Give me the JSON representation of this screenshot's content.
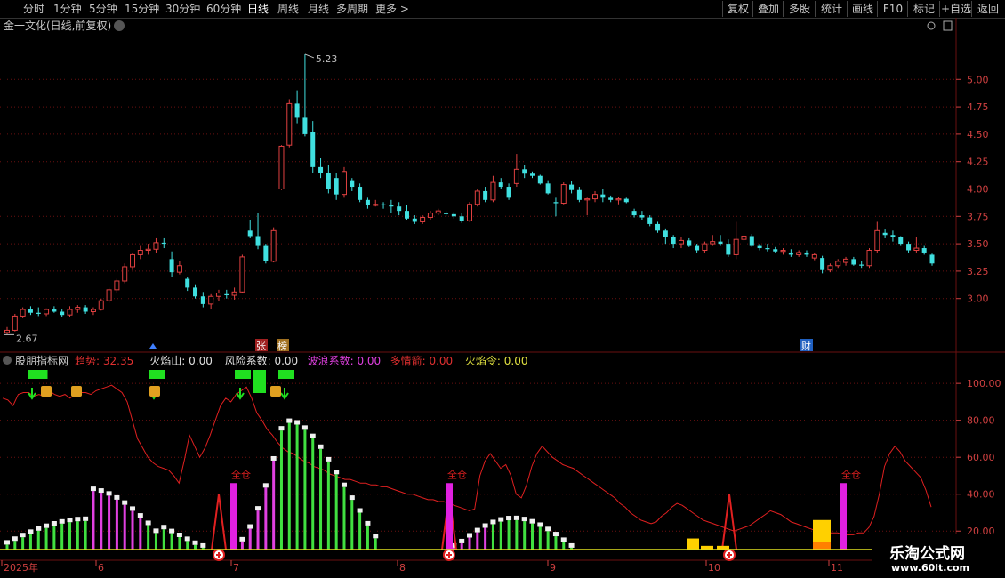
{
  "toolbar": {
    "periods": [
      "分时",
      "1分钟",
      "5分钟",
      "15分钟",
      "30分钟",
      "60分钟",
      "日线",
      "周线",
      "月线",
      "多周期",
      "更多 >"
    ],
    "active": "日线",
    "right": [
      "复权",
      "叠加",
      "多股",
      "统计",
      "画线",
      "F10",
      "标记",
      "+自选",
      "返回"
    ]
  },
  "main_title": "金一文化(日线,前复权)",
  "sub_title": "股朋指标网",
  "indicators": [
    {
      "name": "趋势:",
      "value": "32.35",
      "color": "#e03030"
    },
    {
      "name": "火焰山:",
      "value": "0.00",
      "color": "#e0e0e0"
    },
    {
      "name": "风险系数:",
      "value": "0.00",
      "color": "#e0e0e0"
    },
    {
      "name": "波浪系数:",
      "value": "0.00",
      "color": "#e040e0"
    },
    {
      "name": "多情箭:",
      "value": "0.00",
      "color": "#e03030"
    },
    {
      "name": "火焰令:",
      "value": "0.00",
      "color": "#e0e040"
    }
  ],
  "markers": {
    "zhang": "张",
    "bang": "榜",
    "cai": "财",
    "quancang": "全仓",
    "max_label": "5.23",
    "min_label": "2.67"
  },
  "x_labels": [
    "2025年",
    "6",
    "7",
    "8",
    "9",
    "10",
    "11"
  ],
  "watermark": {
    "line1": "乐淘公式网",
    "line2": "www.60lt.com"
  },
  "colors": {
    "up": "#e04040",
    "down": "#40e0e0",
    "grid": "#6a1010",
    "bg": "#000000"
  },
  "chart_data": [
    {
      "type": "candlestick",
      "title": "金一文化(日线,前复权)",
      "ylim": [
        2.6,
        5.4
      ],
      "yticks": [
        3.0,
        3.25,
        3.5,
        3.75,
        4.0,
        4.25,
        4.5,
        4.75,
        5.0
      ],
      "ohlc": [
        [
          2.69,
          2.74,
          2.67,
          2.71
        ],
        [
          2.71,
          2.86,
          2.7,
          2.84
        ],
        [
          2.84,
          2.92,
          2.82,
          2.9
        ],
        [
          2.9,
          2.93,
          2.85,
          2.87
        ],
        [
          2.87,
          2.92,
          2.84,
          2.86
        ],
        [
          2.86,
          2.91,
          2.84,
          2.9
        ],
        [
          2.9,
          2.93,
          2.87,
          2.88
        ],
        [
          2.88,
          2.9,
          2.83,
          2.85
        ],
        [
          2.85,
          2.93,
          2.83,
          2.9
        ],
        [
          2.9,
          2.94,
          2.87,
          2.92
        ],
        [
          2.92,
          2.94,
          2.86,
          2.88
        ],
        [
          2.88,
          2.92,
          2.85,
          2.9
        ],
        [
          2.9,
          3.0,
          2.89,
          2.98
        ],
        [
          2.98,
          3.1,
          2.96,
          3.08
        ],
        [
          3.08,
          3.18,
          3.05,
          3.16
        ],
        [
          3.16,
          3.32,
          3.14,
          3.29
        ],
        [
          3.29,
          3.42,
          3.26,
          3.4
        ],
        [
          3.4,
          3.48,
          3.36,
          3.44
        ],
        [
          3.44,
          3.5,
          3.4,
          3.45
        ],
        [
          3.45,
          3.55,
          3.42,
          3.51
        ],
        [
          3.51,
          3.55,
          3.46,
          3.5
        ],
        [
          3.36,
          3.43,
          3.2,
          3.24
        ],
        [
          3.24,
          3.34,
          3.22,
          3.3
        ],
        [
          3.18,
          3.2,
          3.07,
          3.1
        ],
        [
          3.1,
          3.13,
          3.0,
          3.02
        ],
        [
          3.02,
          3.06,
          2.92,
          2.95
        ],
        [
          2.95,
          3.04,
          2.9,
          3.02
        ],
        [
          3.02,
          3.08,
          2.98,
          3.05
        ],
        [
          3.04,
          3.08,
          3.0,
          3.03
        ],
        [
          3.03,
          3.1,
          2.99,
          3.06
        ],
        [
          3.06,
          3.4,
          3.05,
          3.38
        ],
        [
          3.62,
          3.72,
          3.55,
          3.57
        ],
        [
          3.57,
          3.78,
          3.45,
          3.48
        ],
        [
          3.48,
          3.5,
          3.32,
          3.34
        ],
        [
          3.34,
          3.65,
          3.33,
          3.62
        ],
        [
          4.0,
          4.4,
          3.99,
          4.39
        ],
        [
          4.4,
          4.82,
          4.38,
          4.78
        ],
        [
          4.78,
          4.9,
          4.6,
          4.65
        ],
        [
          4.65,
          5.23,
          4.48,
          4.5
        ],
        [
          4.52,
          4.62,
          4.15,
          4.2
        ],
        [
          4.2,
          4.28,
          4.1,
          4.15
        ],
        [
          4.15,
          4.22,
          3.96,
          4.0
        ],
        [
          4.1,
          4.15,
          3.9,
          3.95
        ],
        [
          3.95,
          4.2,
          3.92,
          4.16
        ],
        [
          4.08,
          4.1,
          3.98,
          4.02
        ],
        [
          4.02,
          4.05,
          3.88,
          3.9
        ],
        [
          3.9,
          3.92,
          3.82,
          3.85
        ],
        [
          3.85,
          3.9,
          3.84,
          3.86
        ],
        [
          3.86,
          3.88,
          3.82,
          3.85
        ],
        [
          3.85,
          3.9,
          3.78,
          3.84
        ],
        [
          3.84,
          3.88,
          3.76,
          3.8
        ],
        [
          3.8,
          3.85,
          3.72,
          3.73
        ],
        [
          3.73,
          3.76,
          3.68,
          3.7
        ],
        [
          3.7,
          3.76,
          3.68,
          3.74
        ],
        [
          3.74,
          3.8,
          3.72,
          3.78
        ],
        [
          3.78,
          3.82,
          3.76,
          3.8
        ],
        [
          3.78,
          3.8,
          3.75,
          3.77
        ],
        [
          3.77,
          3.79,
          3.73,
          3.75
        ],
        [
          3.75,
          3.78,
          3.69,
          3.71
        ],
        [
          3.71,
          3.88,
          3.7,
          3.86
        ],
        [
          3.86,
          4.0,
          3.84,
          3.98
        ],
        [
          3.98,
          4.02,
          3.88,
          3.9
        ],
        [
          3.9,
          4.12,
          3.88,
          4.06
        ],
        [
          4.06,
          4.1,
          4.0,
          4.02
        ],
        [
          4.02,
          4.05,
          3.9,
          3.92
        ],
        [
          4.05,
          4.32,
          4.02,
          4.18
        ],
        [
          4.18,
          4.22,
          4.1,
          4.14
        ],
        [
          4.14,
          4.16,
          4.1,
          4.12
        ],
        [
          4.12,
          4.13,
          4.04,
          4.05
        ],
        [
          4.05,
          4.08,
          3.95,
          3.96
        ],
        [
          3.88,
          3.92,
          3.75,
          3.87
        ],
        [
          3.87,
          4.06,
          3.86,
          4.04
        ],
        [
          4.04,
          4.07,
          3.96,
          3.99
        ],
        [
          3.99,
          4.02,
          3.88,
          3.9
        ],
        [
          3.9,
          3.92,
          3.76,
          3.91
        ],
        [
          3.91,
          3.98,
          3.88,
          3.95
        ],
        [
          3.95,
          4.0,
          3.88,
          3.92
        ],
        [
          3.92,
          3.94,
          3.88,
          3.9
        ],
        [
          3.9,
          3.93,
          3.86,
          3.91
        ],
        [
          3.91,
          3.92,
          3.87,
          3.88
        ],
        [
          3.8,
          3.82,
          3.74,
          3.76
        ],
        [
          3.76,
          3.8,
          3.72,
          3.74
        ],
        [
          3.74,
          3.76,
          3.66,
          3.68
        ],
        [
          3.68,
          3.7,
          3.6,
          3.62
        ],
        [
          3.62,
          3.64,
          3.5,
          3.56
        ],
        [
          3.56,
          3.58,
          3.46,
          3.5
        ],
        [
          3.5,
          3.56,
          3.46,
          3.53
        ],
        [
          3.53,
          3.55,
          3.47,
          3.48
        ],
        [
          3.48,
          3.5,
          3.42,
          3.44
        ],
        [
          3.44,
          3.52,
          3.42,
          3.5
        ],
        [
          3.5,
          3.58,
          3.48,
          3.52
        ],
        [
          3.52,
          3.58,
          3.48,
          3.5
        ],
        [
          3.5,
          3.54,
          3.38,
          3.4
        ],
        [
          3.4,
          3.7,
          3.36,
          3.54
        ],
        [
          3.54,
          3.58,
          3.52,
          3.57
        ],
        [
          3.57,
          3.59,
          3.47,
          3.48
        ],
        [
          3.48,
          3.5,
          3.44,
          3.46
        ],
        [
          3.46,
          3.5,
          3.43,
          3.45
        ],
        [
          3.45,
          3.47,
          3.42,
          3.43
        ],
        [
          3.43,
          3.46,
          3.4,
          3.44
        ],
        [
          3.42,
          3.45,
          3.38,
          3.4
        ],
        [
          3.4,
          3.44,
          3.38,
          3.42
        ],
        [
          3.42,
          3.44,
          3.38,
          3.4
        ],
        [
          3.37,
          3.42,
          3.35,
          3.4
        ],
        [
          3.37,
          3.39,
          3.23,
          3.26
        ],
        [
          3.26,
          3.32,
          3.24,
          3.3
        ],
        [
          3.3,
          3.36,
          3.28,
          3.34
        ],
        [
          3.33,
          3.38,
          3.3,
          3.36
        ],
        [
          3.36,
          3.38,
          3.3,
          3.31
        ],
        [
          3.31,
          3.34,
          3.28,
          3.3
        ],
        [
          3.3,
          3.46,
          3.28,
          3.44
        ],
        [
          3.44,
          3.7,
          3.42,
          3.62
        ],
        [
          3.6,
          3.63,
          3.55,
          3.58
        ],
        [
          3.58,
          3.62,
          3.52,
          3.56
        ],
        [
          3.56,
          3.57,
          3.48,
          3.5
        ],
        [
          3.5,
          3.52,
          3.42,
          3.44
        ],
        [
          3.44,
          3.56,
          3.42,
          3.46
        ],
        [
          3.46,
          3.48,
          3.4,
          3.42
        ],
        [
          3.4,
          3.41,
          3.3,
          3.32
        ]
      ]
    },
    {
      "type": "bar",
      "title": "股朋指标网",
      "ylim": [
        10,
        115
      ],
      "yticks": [
        20,
        40,
        60,
        80,
        100
      ],
      "series": [
        {
          "name": "趋势",
          "values": [
            92,
            91,
            88,
            94,
            95,
            95,
            93,
            94,
            93,
            96,
            94,
            93,
            94,
            92,
            94,
            95,
            95,
            94,
            96,
            97,
            98,
            99,
            97,
            95,
            90,
            80,
            70,
            65,
            60,
            57,
            55,
            54,
            53,
            50,
            46,
            58,
            72,
            66,
            60,
            65,
            72,
            80,
            88,
            92,
            90,
            94,
            96,
            98,
            92,
            84,
            80,
            75,
            72,
            68,
            65,
            63,
            62,
            60,
            58,
            57,
            55,
            54,
            53,
            51,
            50,
            49,
            48,
            48,
            47,
            46,
            46,
            45,
            45,
            44,
            44,
            43,
            42,
            41,
            40,
            40,
            39,
            38,
            37,
            37,
            36,
            36,
            35,
            34,
            33,
            32,
            31,
            32,
            50,
            58,
            62,
            58,
            54,
            56,
            50,
            40,
            38,
            45,
            55,
            62,
            66,
            63,
            60,
            58,
            56,
            55,
            54,
            52,
            50,
            48,
            46,
            44,
            42,
            40,
            38,
            35,
            33,
            30,
            28,
            26,
            25,
            24,
            25,
            28,
            30,
            33,
            35,
            34,
            32,
            30,
            28,
            26,
            25,
            24,
            23,
            22,
            21,
            20,
            21,
            22,
            23,
            25,
            27,
            29,
            31,
            30,
            29,
            27,
            25,
            24,
            23,
            22,
            21,
            20,
            20,
            19,
            19,
            19,
            18,
            18,
            18,
            19,
            19,
            22,
            28,
            40,
            55,
            62,
            66,
            63,
            58,
            55,
            52,
            49,
            42,
            33
          ]
        }
      ]
    }
  ]
}
